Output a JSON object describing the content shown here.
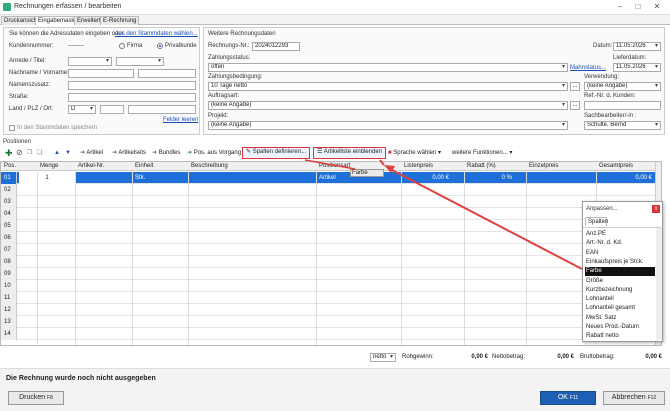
{
  "window": {
    "title": "Rechnungen erfassen / bearbeiten"
  },
  "tabs": [
    "Druckansicht",
    "Eingabemaske",
    "Erweitert",
    "E-Rechnung"
  ],
  "address": {
    "hint": "Sie können die Adressdaten eingeben oder",
    "hint_link": "aus den Stammdaten wählen...",
    "kundennummer_label": "Kundennummer:",
    "kundennummer_value": "--------",
    "firma_label": "Firma",
    "privat_label": "Privatkunde",
    "anrede_label": "Anrede / Titel:",
    "name_label": "Nachname / Vorname:",
    "namenszusatz_label": "Namenszusatz:",
    "strasse_label": "Straße:",
    "land_label": "Land / PLZ / Ort:",
    "land_value": "D",
    "felder_leeren": "Felder leeren",
    "save_label": "In den Stammdaten speichern"
  },
  "invoice": {
    "section_title": "Weitere Rechnungsdaten",
    "nr_label": "Rechnungs-Nr.:",
    "nr_value": "2024012293",
    "datum_label": "Datum:",
    "datum_value": "11.05.2026",
    "status_label": "Zahlungsstatus:",
    "status_value": "offen",
    "mahnstatus": "Mahnstatus...",
    "lieferdatum_label": "Lieferdatum:",
    "lieferdatum_value": "11.05.2026",
    "bedingung_label": "Zahlungsbedingung:",
    "bedingung_value": "10 Tage netto",
    "verwendung_label": "Verwendung:",
    "verwendung_value": "(keine Angabe)",
    "auftragsart_label": "Auftragsart:",
    "auftragsart_value": "(keine Angabe)",
    "ref_label": "Ref.-Nr. d. Kunden:",
    "projekt_label": "Projekt:",
    "projekt_value": "(keine Angabe)",
    "sachbearbeiter_label": "Sachbearbeiter/-in :",
    "sachbearbeiter_value": "Schulte, Bernd",
    "dots": "..."
  },
  "positions": {
    "title": "Positionen",
    "toolbar": {
      "artikel": "Artikel",
      "artikelsets": "Artikelsets",
      "bundles": "Bundles",
      "pos_vorgang": "Pos. aus Vorgang",
      "spalten": "Spalten definieren...",
      "artikelliste": "Artikelliste einblenden",
      "sprache": "Sprache wählen",
      "weitere": "weitere Funktionen..."
    },
    "columns": [
      "Pos.",
      "Menge",
      "Artikel-Nr.",
      "Einheit",
      "Beschreibung",
      "Positionsart",
      "Listenpreis",
      "Rabatt (%)",
      "Einzelpreis",
      "Gesamtpreis"
    ],
    "first_row": {
      "menge": "1",
      "einheit": "Stk.",
      "positionsart": "Artikel",
      "listenpreis": "0,00 €",
      "rabatt": "0 %",
      "gesamtpreis": "0,00 €"
    },
    "row_numbers": [
      "01",
      "02",
      "03",
      "04",
      "05",
      "06",
      "07",
      "08",
      "09",
      "10",
      "11",
      "12",
      "13",
      "14"
    ],
    "drag_tooltip": "Farbe"
  },
  "popup": {
    "title": "Anpassen...",
    "tab": "Spalten",
    "close": "x",
    "items": [
      "Anz.PE",
      "Art.-Nr. d. Kd.",
      "EAN",
      "Einkaufspreis je Stck.",
      "Farbe",
      "Größe",
      "Kurzbezeichnung",
      "Lohnanteil",
      "Lohnanteil gesamt",
      "MwSt. Satz",
      "Neues Prod.-Datum",
      "Rabatt netto"
    ],
    "selected_index": 4
  },
  "summary": {
    "netto_select": "netto",
    "rohgewinn_label": "Rohgewinn:",
    "rohgewinn_value": "0,00 €",
    "nettobetrag_label": "Nettobetrag:",
    "nettobetrag_value": "0,00 €",
    "bruttobetrag_label": "Bruttobetrag:",
    "bruttobetrag_value": "0,00 €"
  },
  "status_message": "Die Rechnung wurde noch nicht ausgegeben",
  "buttons": {
    "drucken": "Drucken",
    "drucken_key": "F8",
    "ok": "OK",
    "ok_key": "F11",
    "abbrechen": "Abbrechen",
    "abbrechen_key": "F12"
  }
}
